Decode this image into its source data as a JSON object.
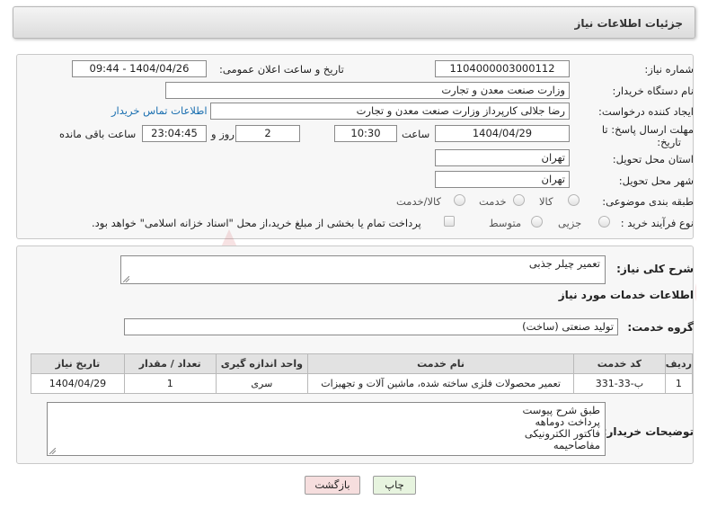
{
  "header": {
    "title": "جزئیات اطلاعات نیاز"
  },
  "form": {
    "need_number_label": "شماره نیاز:",
    "need_number": "1104000003000112",
    "announce_label": "تاریخ و ساعت اعلان عمومی:",
    "announce_value": "1404/04/26 - 09:44",
    "buyer_org_label": "نام دستگاه خریدار:",
    "buyer_org": "وزارت صنعت معدن و تجارت",
    "creator_label": "ایجاد کننده درخواست:",
    "creator": "رضا جلالی کارپرداز وزارت صنعت معدن و تجارت",
    "contact_link": "اطلاعات تماس خریدار",
    "deadline_label_1": "مهلت ارسال پاسخ: تا",
    "deadline_label_2": "تاریخ:",
    "deadline_date": "1404/04/29",
    "time_label": "ساعت",
    "deadline_time": "10:30",
    "days_value": "2",
    "days_label": "روز و",
    "remaining_time": "23:04:45",
    "remaining_label": "ساعت باقی مانده",
    "province_label": "استان محل تحویل:",
    "province": "تهران",
    "city_label": "شهر محل تحویل:",
    "city": "تهران",
    "category_label": "طبقه بندی موضوعی:",
    "category_options": [
      "کالا",
      "خدمت",
      "کالا/خدمت"
    ],
    "purchase_type_label": "نوع فرآیند خرید :",
    "purchase_options": [
      "جزیی",
      "متوسط"
    ],
    "payment_note": "پرداخت تمام یا بخشی از مبلغ خرید،از محل \"اسناد خزانه اسلامی\" خواهد بود."
  },
  "details": {
    "description_label": "شرح کلی نیاز:",
    "description": "تعمیر چیلر جذبی",
    "services_title": "اطلاعات خدمات مورد نیاز",
    "service_group_label": "گروه خدمت:",
    "service_group": "تولید صنعتی (ساخت)",
    "table": {
      "headers": [
        "ردیف",
        "کد خدمت",
        "نام خدمت",
        "واحد اندازه گیری",
        "تعداد / مقدار",
        "تاریخ نیاز"
      ],
      "rows": [
        [
          "1",
          "ب-33-331",
          "تعمیر محصولات فلزی ساخته شده، ماشین آلات و تجهیزات",
          "سری",
          "1",
          "1404/04/29"
        ]
      ]
    },
    "buyer_notes_label": "توضیحات خریدار:",
    "buyer_notes": [
      "طبق شرح پیوست",
      "پرداخت دوماهه",
      "فاکتور الکترونیکی",
      "مفاصاحیمه"
    ]
  },
  "buttons": {
    "print": "چاپ",
    "back": "بازگشت"
  },
  "watermark": "AriaTender.neT",
  "colors": {
    "link": "#1a6fb0",
    "back_button": "#f6dede",
    "print_button": "#e7f4df",
    "watermark": "#c8282d"
  }
}
